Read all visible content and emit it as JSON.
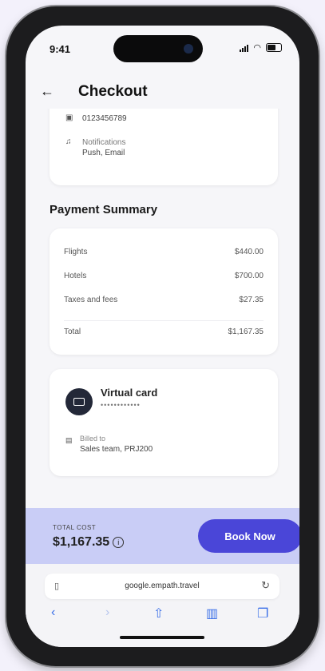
{
  "status": {
    "time": "9:41"
  },
  "header": {
    "title": "Checkout"
  },
  "contact": {
    "phone": "0123456789",
    "notifications_label": "Notifications",
    "notifications_value": "Push, Email"
  },
  "summary": {
    "title": "Payment Summary",
    "rows": [
      {
        "label": "Flights",
        "value": "$440.00"
      },
      {
        "label": "Hotels",
        "value": "$700.00"
      },
      {
        "label": "Taxes and fees",
        "value": "$27.35"
      }
    ],
    "total_label": "Total",
    "total_value": "$1,167.35"
  },
  "payment": {
    "method": "Virtual card",
    "masked": "••••••••••••",
    "billed_to_label": "Billed to",
    "billed_to_value": "Sales team, PRJ200"
  },
  "footer": {
    "total_cost_label": "TOTAL COST",
    "total_cost_value": "$1,167.35",
    "book_label": "Book Now"
  },
  "browser": {
    "url": "google.empath.travel"
  },
  "colors": {
    "accent": "#4a46d8",
    "footer_bg": "#c9cdf6"
  }
}
